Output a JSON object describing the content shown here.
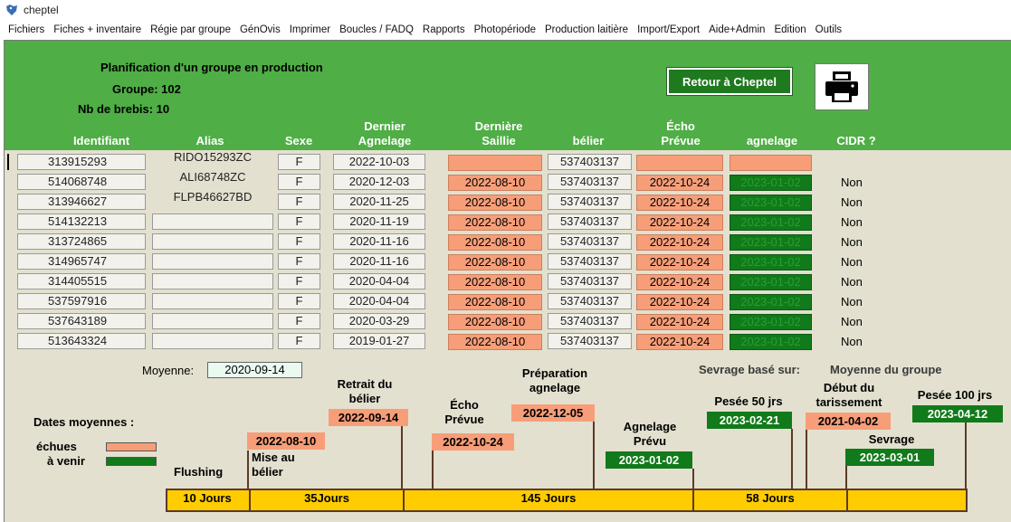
{
  "window": {
    "title": "cheptel"
  },
  "menu": [
    "Fichiers",
    "Fiches + inventaire",
    "Régie par groupe",
    "GénOvis",
    "Imprimer",
    "Boucles / FADQ",
    "Rapports",
    "Photopériode",
    "Production laitière",
    "Import/Export",
    "Aide+Admin",
    "Edition",
    "Outils"
  ],
  "header": {
    "title": "Planification d'un groupe en production",
    "groupe_label": "Groupe: 102",
    "brebis_label": "Nb de brebis: 10",
    "retour_button": "Retour à Cheptel",
    "columns": {
      "identifiant": "Identifiant",
      "alias": "Alias",
      "sexe": "Sexe",
      "dernier_agnelage_1": "Dernier",
      "dernier_agnelage_2": "Agnelage",
      "derniere_saillie_1": "Dernière",
      "derniere_saillie_2": "Saillie",
      "belier": "bélier",
      "echo_prevue_1": "Écho",
      "echo_prevue_2": "Prévue",
      "agnelage": "agnelage",
      "cidr": "CIDR ?"
    }
  },
  "rows": [
    {
      "id": "313915293",
      "alias": "RIDO15293ZC",
      "sexe": "F",
      "dernier_agnelage": "2022-10-03",
      "saillie": "",
      "belier": "537403137",
      "echo": "",
      "agnelage": "",
      "cidr": ""
    },
    {
      "id": "514068748",
      "alias": "ALI68748ZC",
      "sexe": "F",
      "dernier_agnelage": "2020-12-03",
      "saillie": "2022-08-10",
      "belier": "537403137",
      "echo": "2022-10-24",
      "agnelage": "2023-01-02",
      "cidr": "Non"
    },
    {
      "id": "313946627",
      "alias": "FLPB46627BD",
      "sexe": "F",
      "dernier_agnelage": "2020-11-25",
      "saillie": "2022-08-10",
      "belier": "537403137",
      "echo": "2022-10-24",
      "agnelage": "2023-01-02",
      "cidr": "Non"
    },
    {
      "id": "514132213",
      "alias": "",
      "sexe": "F",
      "dernier_agnelage": "2020-11-19",
      "saillie": "2022-08-10",
      "belier": "537403137",
      "echo": "2022-10-24",
      "agnelage": "2023-01-02",
      "cidr": "Non"
    },
    {
      "id": "313724865",
      "alias": "",
      "sexe": "F",
      "dernier_agnelage": "2020-11-16",
      "saillie": "2022-08-10",
      "belier": "537403137",
      "echo": "2022-10-24",
      "agnelage": "2023-01-02",
      "cidr": "Non"
    },
    {
      "id": "314965747",
      "alias": "",
      "sexe": "F",
      "dernier_agnelage": "2020-11-16",
      "saillie": "2022-08-10",
      "belier": "537403137",
      "echo": "2022-10-24",
      "agnelage": "2023-01-02",
      "cidr": "Non"
    },
    {
      "id": "314405515",
      "alias": "",
      "sexe": "F",
      "dernier_agnelage": "2020-04-04",
      "saillie": "2022-08-10",
      "belier": "537403137",
      "echo": "2022-10-24",
      "agnelage": "2023-01-02",
      "cidr": "Non"
    },
    {
      "id": "537597916",
      "alias": "",
      "sexe": "F",
      "dernier_agnelage": "2020-04-04",
      "saillie": "2022-08-10",
      "belier": "537403137",
      "echo": "2022-10-24",
      "agnelage": "2023-01-02",
      "cidr": "Non"
    },
    {
      "id": "537643189",
      "alias": "",
      "sexe": "F",
      "dernier_agnelage": "2020-03-29",
      "saillie": "2022-08-10",
      "belier": "537403137",
      "echo": "2022-10-24",
      "agnelage": "2023-01-02",
      "cidr": "Non"
    },
    {
      "id": "513643324",
      "alias": "",
      "sexe": "F",
      "dernier_agnelage": "2019-01-27",
      "saillie": "2022-08-10",
      "belier": "537403137",
      "echo": "2022-10-24",
      "agnelage": "2023-01-02",
      "cidr": "Non"
    }
  ],
  "moyenne": {
    "label": "Moyenne:",
    "value": "2020-09-14"
  },
  "sevrage_base": {
    "label": "Sevrage basé sur:",
    "value": "Moyenne du groupe"
  },
  "legend": {
    "title": "Dates moyennes :",
    "echues": "échues",
    "a_venir": "à venir"
  },
  "timeline": {
    "flushing": "Flushing",
    "mise_au_belier_1": "Mise au",
    "mise_au_belier_2": "bélier",
    "mise_au_belier_date": "2022-08-10",
    "retrait_1": "Retrait du",
    "retrait_2": "bélier",
    "retrait_date": "2022-09-14",
    "echo_1": "Écho",
    "echo_2": "Prévue",
    "echo_date": "2022-10-24",
    "preparation_1": "Préparation",
    "preparation_2": "agnelage",
    "preparation_date": "2022-12-05",
    "agnelage_1": "Agnelage",
    "agnelage_2": "Prévu",
    "agnelage_date": "2023-01-02",
    "pesee50": "Pesée 50 jrs",
    "pesee50_date": "2023-02-21",
    "tarissement_1": "Début du",
    "tarissement_2": "tarissement",
    "tarissement_date": "2021-04-02",
    "sevrage": "Sevrage",
    "sevrage_date": "2023-03-01",
    "pesee100": "Pesée 100 jrs",
    "pesee100_date": "2023-04-12",
    "segments": [
      "10 Jours",
      "35Jours",
      "145 Jours",
      "58 Jours",
      ""
    ]
  },
  "colors": {
    "header_green": "#4fae45",
    "background": "#e3e0cf",
    "past_orange": "#f79e79",
    "future_green": "#117a1a",
    "timeline_yellow": "#ffcc00"
  }
}
